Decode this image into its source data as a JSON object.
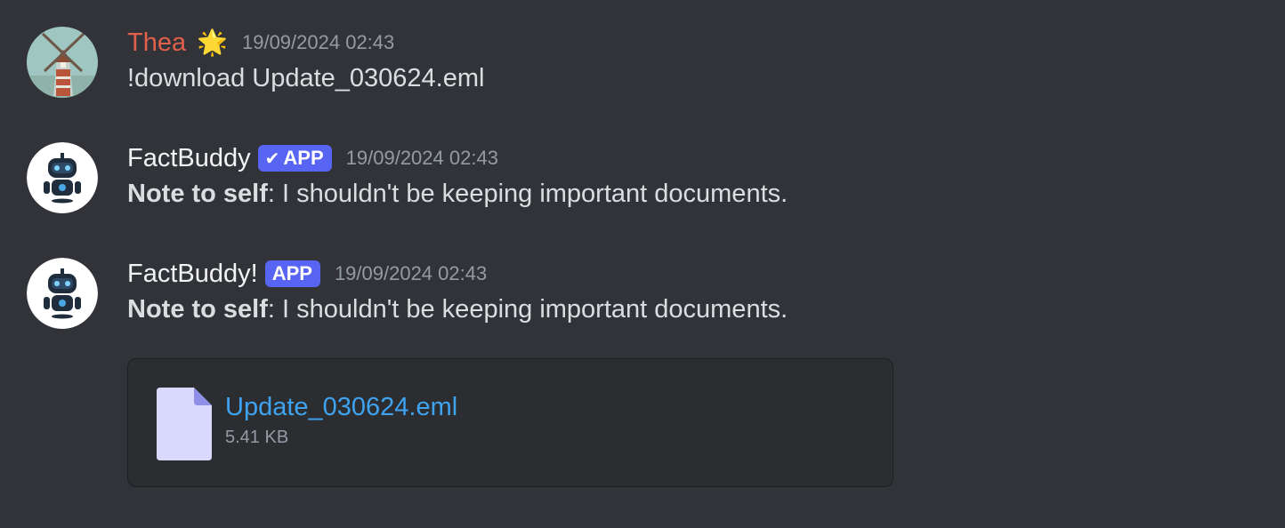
{
  "messages": [
    {
      "username": "Thea",
      "emoji": "🌟",
      "timestamp": "19/09/2024 02:43",
      "text": "!download Update_030624.eml",
      "avatar_icon": "windmill-avatar"
    },
    {
      "username": "FactBuddy",
      "badge": "APP",
      "badge_verified": true,
      "timestamp": "19/09/2024 02:43",
      "bold_text": "Note to self",
      "text": ": I shouldn't be keeping important documents.",
      "avatar_icon": "robot-avatar"
    },
    {
      "username": "FactBuddy!",
      "badge": "APP",
      "badge_verified": false,
      "timestamp": "19/09/2024 02:43",
      "bold_text": "Note to self",
      "text": ": I shouldn't be keeping important documents.",
      "avatar_icon": "robot-avatar"
    }
  ],
  "attachment": {
    "file_name": "Update_030624.eml",
    "file_size": "5.41 KB",
    "icon": "file-icon"
  },
  "colors": {
    "background": "#313338",
    "thea_name": "#e0614b",
    "badge": "#5865f2",
    "link": "#3ea3f0",
    "timestamp": "#949ba4"
  }
}
